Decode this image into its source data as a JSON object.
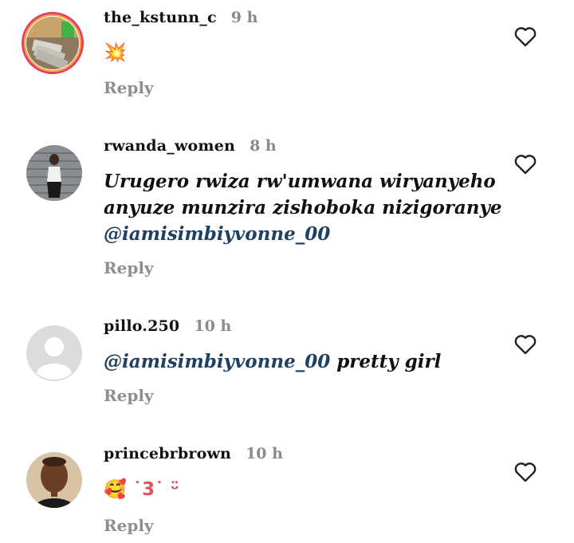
{
  "comments": [
    {
      "username": "the_kstunn_c",
      "time": "9 h",
      "text": "💥",
      "reply_label": "Reply"
    },
    {
      "username": "rwanda_women",
      "time": "8 h",
      "text_line1": "Urugero rwiza rw'umwana wiryanyeho",
      "text_line2": "anyuze munzira zishoboka nizigoranye",
      "mention": "@iamisimbiyvonne_00",
      "reply_label": "Reply"
    },
    {
      "username": "pillo.250",
      "time": "10 h",
      "mention": "@iamisimbiyvonne_00",
      "text": " pretty girl",
      "reply_label": "Reply"
    },
    {
      "username": "princebrbrown",
      "time": "10 h",
      "text": "🥰 ˙3˙ ᵕ̈",
      "reply_label": "Reply"
    }
  ],
  "icons": {
    "like": "heart-outline-icon"
  },
  "colors": {
    "mention": "#1f3f63",
    "secondary_text": "#8e8e8e",
    "story_ring": "#e4405f"
  }
}
